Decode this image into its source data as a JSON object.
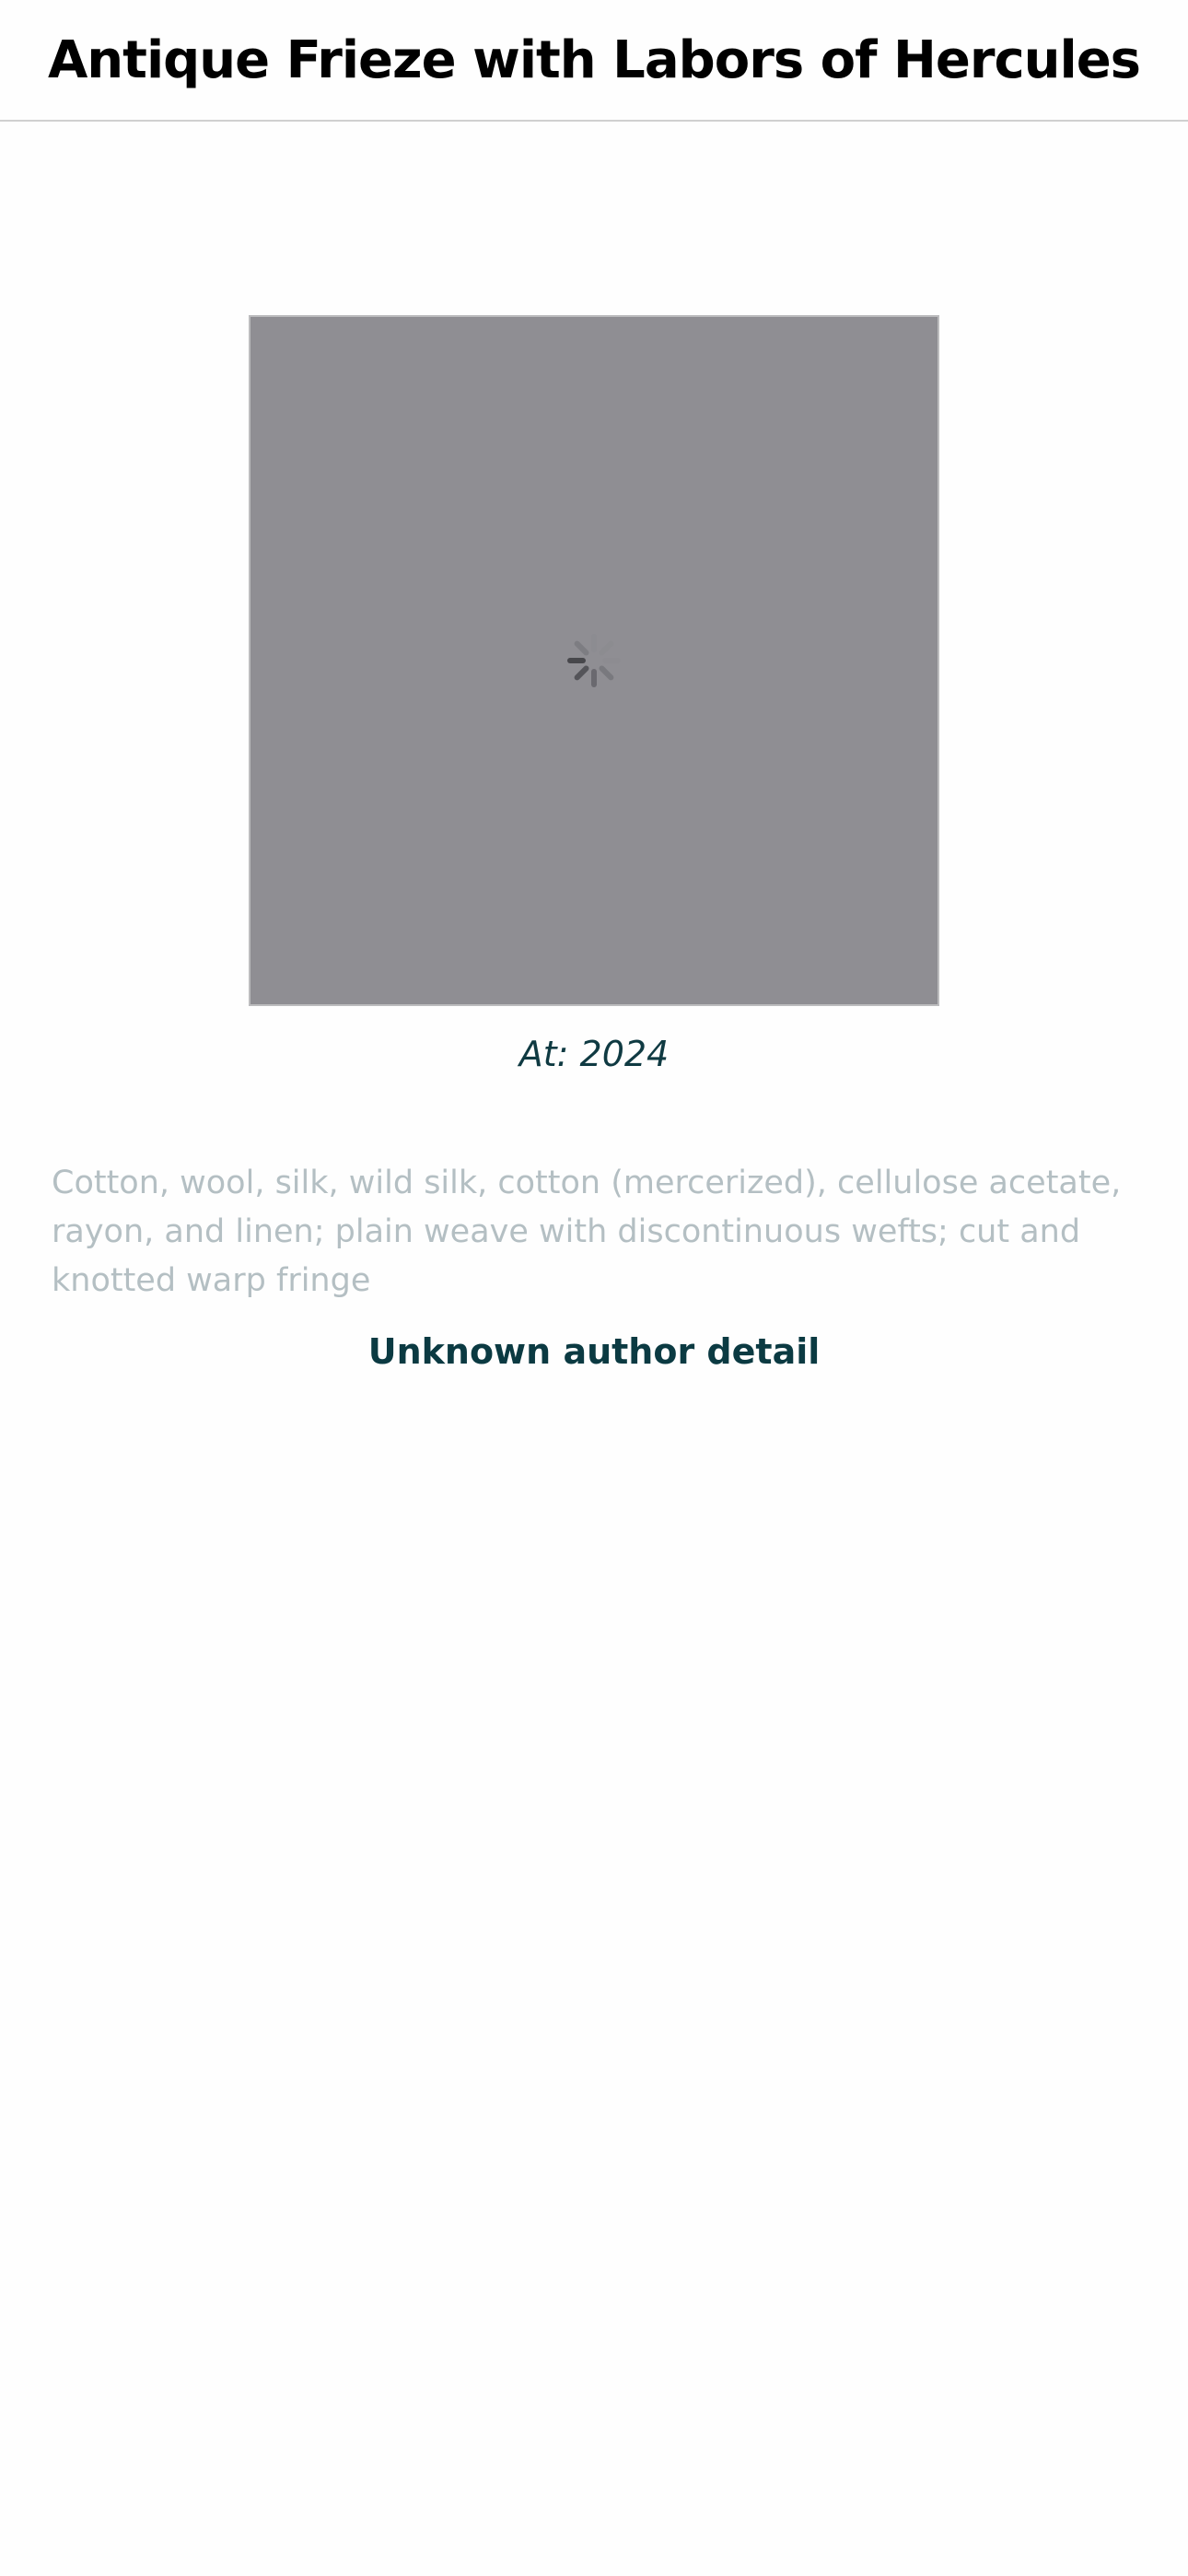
{
  "header": {
    "title": "Antique Frieze with Labors of Hercules"
  },
  "artwork": {
    "image_state": "loading",
    "spinner_icon": "loading-spinner-icon",
    "caption": "At: 2024",
    "description": "Cotton, wool, silk, wild silk, cotton (mercerized), cellulose acetate, rayon, and linen; plain weave with discontinuous wefts; cut and knotted warp fringe",
    "author": "Unknown author detail"
  },
  "colors": {
    "background": "#fefefe",
    "title": "#000000",
    "placeholder": "#8f8e93",
    "caption": "#0f3a42",
    "description": "#b4bfc3",
    "author": "#0b3a42",
    "header_border": "#d0d0d0"
  }
}
